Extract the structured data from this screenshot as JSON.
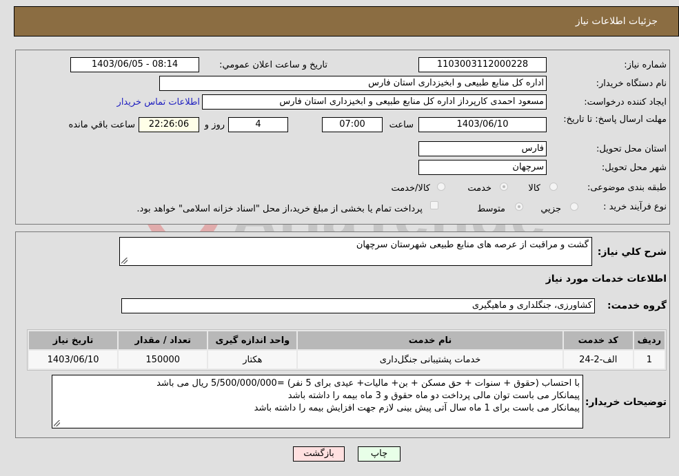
{
  "header": {
    "title": "جزئیات اطلاعات نیاز"
  },
  "form": {
    "need_number_label": "شماره نیاز:",
    "need_number": "1103003112000228",
    "announce_label": "تاریخ و ساعت اعلان عمومي:",
    "announce_value": "1403/06/05 - 08:14",
    "buyer_org_label": "نام دستگاه خریدار:",
    "buyer_org": "اداره کل منابع طبیعی و ابخیزداری استان فارس",
    "creator_label": "ایجاد کننده درخواست:",
    "creator": "مسعود احمدی کارپرداز اداره کل منابع طبیعی و ابخیزداری استان فارس",
    "contact_link": "اطلاعات تماس خریدار",
    "deadline_label": "مهلت ارسال پاسخ: تا تاریخ:",
    "deadline_date": "1403/06/10",
    "time_label": "ساعت",
    "deadline_time": "07:00",
    "days_value": "4",
    "days_label": "روز و",
    "remaining_time": "22:26:06",
    "remaining_label": "ساعت باقي مانده",
    "province_label": "استان محل تحویل:",
    "province": "فارس",
    "city_label": "شهر محل تحویل:",
    "city": "سرچهان",
    "category_label": "طبقه بندی موضوعی:",
    "category_options": [
      "کالا",
      "خدمت",
      "کالا/خدمت"
    ],
    "category_selected": "خدمت",
    "process_label": "نوع فرآیند خرید :",
    "process_options": [
      "جزيي",
      "متوسط"
    ],
    "process_selected": "متوسط",
    "treasury_note": "پرداخت تمام یا بخشی از مبلغ خرید،از محل \"اسناد خزانه اسلامی\" خواهد بود."
  },
  "details": {
    "description_label": "شرح کلي نياز:",
    "description": "گشت و مراقبت از عرصه های منابع طبیعی شهرستان سرچهان",
    "services_heading": "اطلاعات خدمات مورد نیاز",
    "service_group_label": "گروه خدمت:",
    "service_group": "کشاورزی، جنگلداری و ماهیگیری",
    "table": {
      "headers": [
        "ردیف",
        "کد خدمت",
        "نام خدمت",
        "واحد اندازه گیری",
        "تعداد / مقدار",
        "تاریخ نیاز"
      ],
      "rows": [
        [
          "1",
          "الف-2-24",
          "خدمات پشتیبانی جنگل‌داری",
          "هکتار",
          "150000",
          "1403/06/10"
        ]
      ]
    },
    "buyer_notes_label": "توضیحات خریدار:",
    "buyer_notes": [
      "با احتساب  (حقوق + سنوات + حق مسکن + بن+ مالیات+ عیدی برای 5 نفر) =5/500/000/000 ریال می باشد",
      "پیمانکار می باست توان مالی پرداخت دو ماه حقوق و 3 ماه بیمه را داشته باشد",
      "پیمانکار می باست برای 1 ماه سال آتی پیش بینی لازم جهت افزایش بیمه را داشته باشد"
    ]
  },
  "buttons": {
    "print": "چاپ",
    "back": "بازگشت"
  },
  "watermark": {
    "text": "AriaTender.neT"
  }
}
